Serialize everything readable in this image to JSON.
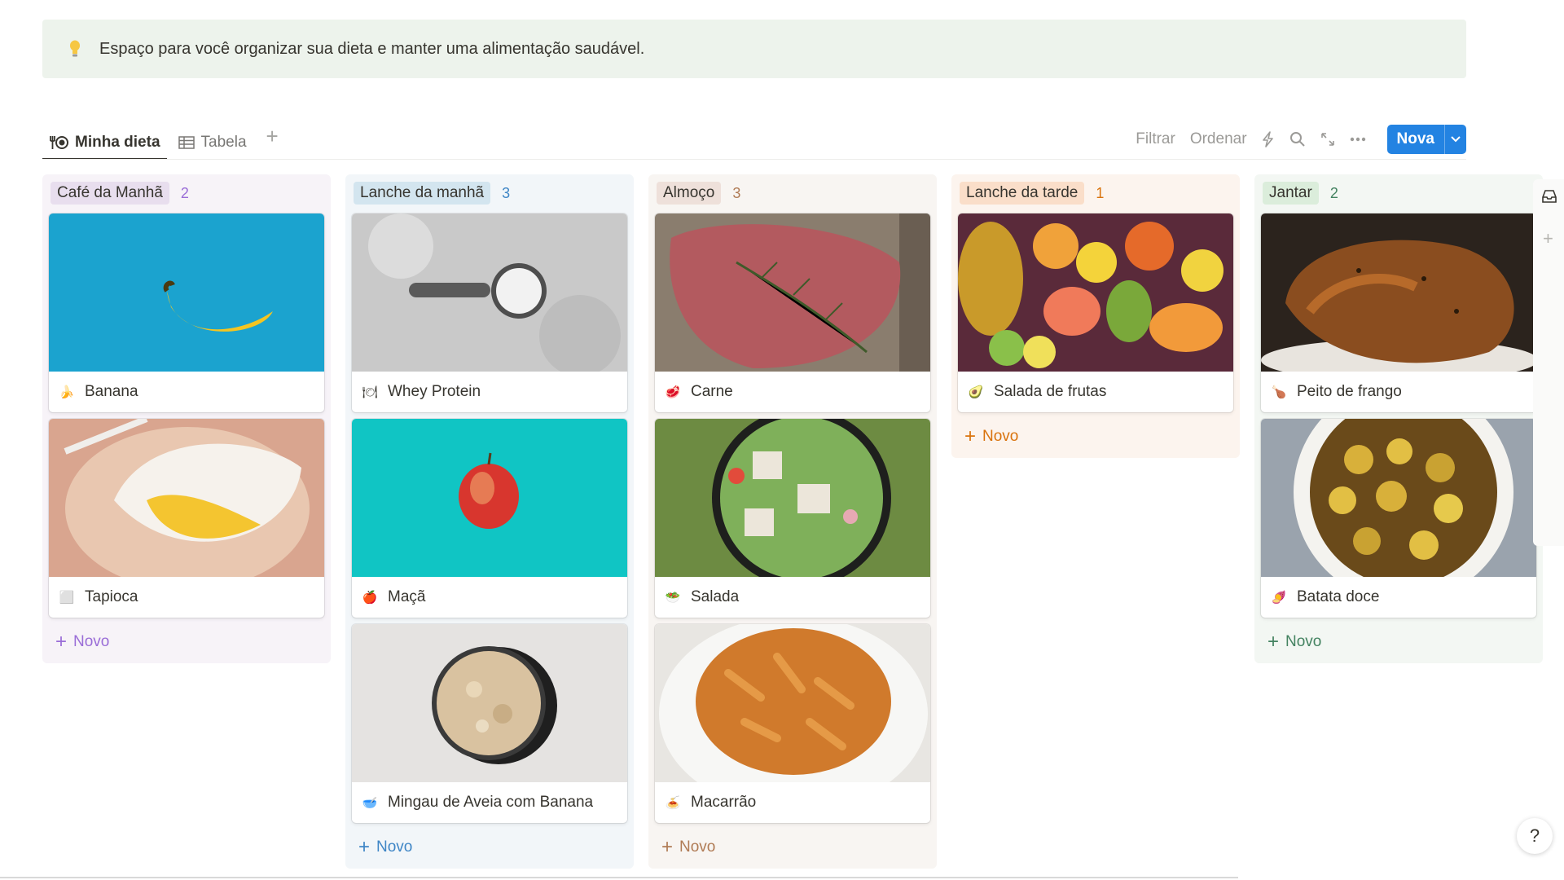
{
  "callout": {
    "text": "Espaço para você organizar sua dieta e manter uma alimentação saudável.",
    "icon": "lightbulb-icon"
  },
  "tabs": [
    {
      "label": "Minha dieta",
      "icon": "fork-plate-icon",
      "active": true
    },
    {
      "label": "Tabela",
      "icon": "table-icon",
      "active": false
    }
  ],
  "toolbar": {
    "filter": "Filtrar",
    "sort": "Ordenar",
    "new": "Nova"
  },
  "board": {
    "add_label": "Novo",
    "columns": [
      {
        "name": "Café da Manhã",
        "count": "2",
        "color": "#9a6dd7",
        "cards": [
          {
            "title": "Banana",
            "emoji": "🍌"
          },
          {
            "title": "Tapioca",
            "emoji": "⬜"
          }
        ]
      },
      {
        "name": "Lanche da manhã",
        "count": "3",
        "color": "#3f86c6",
        "cards": [
          {
            "title": "Whey Protein",
            "emoji": "🍽"
          },
          {
            "title": "Maçã",
            "emoji": "🍎"
          },
          {
            "title": "Mingau de Aveia com Banana",
            "emoji": "🥣"
          }
        ]
      },
      {
        "name": "Almoço",
        "count": "3",
        "color": "#b07b55",
        "cards": [
          {
            "title": "Carne",
            "emoji": "🥩"
          },
          {
            "title": "Salada",
            "emoji": "🥗"
          },
          {
            "title": "Macarrão",
            "emoji": "🍝"
          }
        ]
      },
      {
        "name": "Lanche da tarde",
        "count": "1",
        "color": "#d9730d",
        "cards": [
          {
            "title": "Salada de frutas",
            "emoji": "🥑"
          }
        ]
      },
      {
        "name": "Jantar",
        "count": "2",
        "color": "#448361",
        "cards": [
          {
            "title": "Peito de frango",
            "emoji": "🍗"
          },
          {
            "title": "Batata doce",
            "emoji": "🍠"
          }
        ]
      }
    ]
  },
  "help": "?"
}
